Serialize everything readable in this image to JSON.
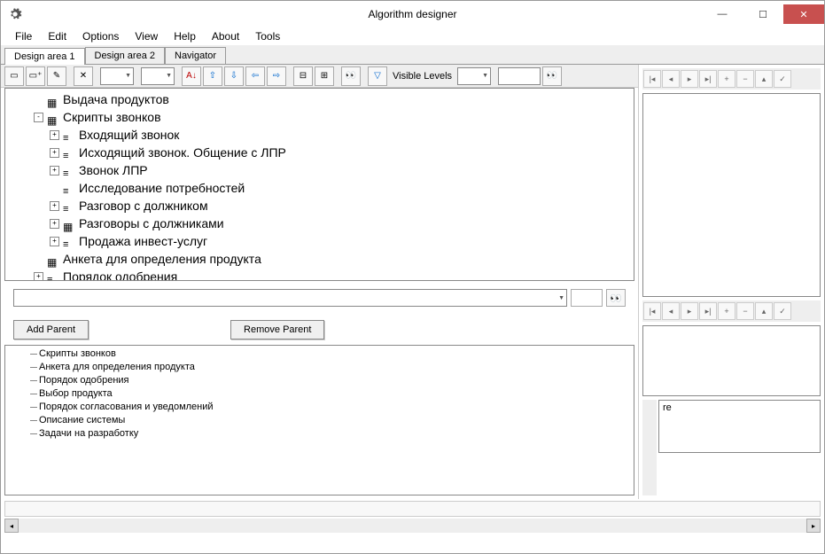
{
  "window": {
    "title": "Algorithm designer"
  },
  "menu": [
    "File",
    "Edit",
    "Options",
    "View",
    "Help",
    "About",
    "Tools"
  ],
  "tabs": [
    {
      "label": "Design area 1",
      "active": true
    },
    {
      "label": "Design area 2",
      "active": false
    },
    {
      "label": "Navigator",
      "active": false
    }
  ],
  "toolbar": {
    "visible_levels_label": "Visible Levels"
  },
  "tree": [
    {
      "indent": 1,
      "expander": "",
      "icon": "grid",
      "label": "Выдача продуктов"
    },
    {
      "indent": 1,
      "expander": "-",
      "icon": "grid",
      "label": "Скрипты звонков"
    },
    {
      "indent": 2,
      "expander": "+",
      "icon": "lines",
      "label": "Входящий звонок"
    },
    {
      "indent": 2,
      "expander": "+",
      "icon": "lines",
      "label": "Исходящий звонок. Общение с ЛПР"
    },
    {
      "indent": 2,
      "expander": "+",
      "icon": "lines",
      "label": "Звонок ЛПР"
    },
    {
      "indent": 2,
      "expander": "",
      "icon": "lines",
      "label": "Исследование потребностей"
    },
    {
      "indent": 2,
      "expander": "+",
      "icon": "lines",
      "label": "Разговор с должником"
    },
    {
      "indent": 2,
      "expander": "+",
      "icon": "grid",
      "label": "Разговоры с должниками"
    },
    {
      "indent": 2,
      "expander": "+",
      "icon": "lines",
      "label": "Продажа инвест-услуг"
    },
    {
      "indent": 1,
      "expander": "",
      "icon": "grid",
      "label": "Анкета для определения продукта"
    },
    {
      "indent": 1,
      "expander": "+",
      "icon": "lines",
      "label": "Порядок одобрения"
    }
  ],
  "buttons": {
    "add_parent": "Add Parent",
    "remove_parent": "Remove Parent"
  },
  "bottom_list": [
    "Скрипты звонков",
    "Анкета для определения продукта",
    "Порядок одобрения",
    "Выбор продукта",
    "Порядок согласования и уведомлений",
    "Описание системы",
    "Задачи на разработку"
  ],
  "right_input": {
    "value": "re"
  }
}
